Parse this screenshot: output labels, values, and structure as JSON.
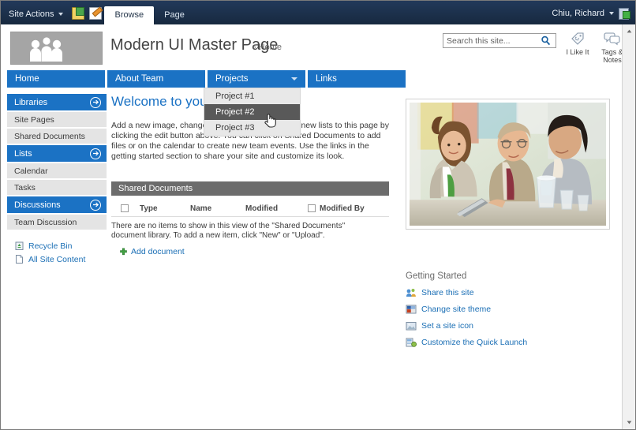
{
  "ribbon": {
    "site_actions_label": "Site Actions",
    "icons": [
      {
        "name": "navigate-up-icon"
      },
      {
        "name": "edit-page-icon"
      }
    ],
    "tabs": [
      {
        "label": "Browse",
        "active": true
      },
      {
        "label": "Page",
        "active": false
      }
    ],
    "user_name": "Chiu, Richard",
    "presence_icon": "presence-online-icon"
  },
  "header": {
    "logo_alt": "site-logo-people-placeholder",
    "title": "Modern UI Master Page",
    "breadcrumb_separator": "›",
    "breadcrumb": "Home"
  },
  "search": {
    "placeholder": "Search this site...",
    "value": "",
    "icon": "search-magnifier-icon"
  },
  "social": [
    {
      "label": "I Like It",
      "icon": "tag-like-icon"
    },
    {
      "label": "Tags &\nNotes",
      "label_line1": "Tags &",
      "label_line2": "Notes",
      "icon": "tags-notes-icon"
    }
  ],
  "topnav": {
    "items": [
      {
        "label": "Home",
        "has_children": false
      },
      {
        "label": "About Team",
        "has_children": false
      },
      {
        "label": "Projects",
        "has_children": true
      },
      {
        "label": "Links",
        "has_children": false
      }
    ],
    "dropdown": {
      "open_for": "Projects",
      "items": [
        {
          "label": "Project #1",
          "hovered": false
        },
        {
          "label": "Project #2",
          "hovered": true
        },
        {
          "label": "Project #3",
          "hovered": false
        }
      ]
    }
  },
  "quicklaunch": {
    "groups": [
      {
        "header": "Libraries",
        "items": [
          "Site Pages",
          "Shared Documents"
        ]
      },
      {
        "header": "Lists",
        "items": [
          "Calendar",
          "Tasks"
        ]
      },
      {
        "header": "Discussions",
        "items": [
          "Team Discussion"
        ]
      }
    ],
    "footer": [
      {
        "label": "Recycle Bin",
        "icon": "recycle-bin-icon"
      },
      {
        "label": "All Site Content",
        "icon": "all-site-content-icon"
      }
    ]
  },
  "content": {
    "welcome_title": "Welcome to your site!",
    "welcome_body": "Add a new image, change this welcome text or add new lists to this page by clicking the edit button above. You can click on Shared Documents to add files or on the calendar to create new team events. Use the links in the getting started section to share your site and customize its look.",
    "webpart": {
      "title": "Shared Documents",
      "columns": [
        "Type",
        "Name",
        "Modified",
        "Modified By"
      ],
      "empty_message": "There are no items to show in this view of the \"Shared Documents\" document library. To add a new item, click \"New\" or \"Upload\".",
      "add_link": "Add document",
      "add_icon": "green-plus-icon"
    }
  },
  "rightcol": {
    "photo_alt": "three-business-people-at-laptop-photo"
  },
  "getting_started": {
    "title": "Getting Started",
    "items": [
      {
        "label": "Share this site",
        "icon": "share-site-icon"
      },
      {
        "label": "Change site theme",
        "icon": "change-theme-icon"
      },
      {
        "label": "Set a site icon",
        "icon": "set-site-icon-icon"
      },
      {
        "label": "Customize the Quick Launch",
        "icon": "customize-quick-launch-icon"
      }
    ]
  },
  "colors": {
    "ribbon_bg": "#1d3049",
    "nav_blue": "#1b72c4",
    "link_blue": "#1b6fb5",
    "webpart_header": "#6c6c6c",
    "hover_gray": "#595959"
  }
}
